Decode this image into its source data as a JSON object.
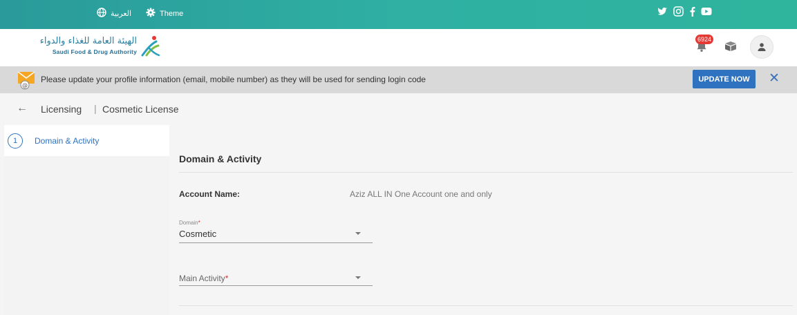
{
  "topbar": {
    "language_label": "العربية",
    "theme_label": "Theme",
    "socials": [
      "twitter-icon",
      "instagram-icon",
      "facebook-icon",
      "youtube-icon"
    ]
  },
  "header": {
    "logo_ar": "الهيئة العامة للغذاء والدواء",
    "logo_en": "Saudi Food & Drug Authority",
    "notification_count": "6924"
  },
  "notice": {
    "text": "Please update your profile information (email, mobile number) as they will be used for sending login code",
    "button_label": "UPDATE NOW",
    "close_label": "✕"
  },
  "breadcrumb": {
    "back": "←",
    "first": "Licensing",
    "separator": "|",
    "second": "Cosmetic License"
  },
  "steps": [
    {
      "number": "1",
      "label": "Domain & Activity"
    }
  ],
  "form": {
    "section_title": "Domain & Activity",
    "account_label": "Account Name:",
    "account_value": "Aziz ALL IN One Account one and only",
    "domain_label": "Domain",
    "domain_value": "Cosmetic",
    "main_activity_label": "Main Activity",
    "required_mark": "*"
  },
  "colors": {
    "topbar": "#2fa8a0",
    "primary": "#2f72c0",
    "badge": "#e53935",
    "required": "#d32f2f"
  }
}
